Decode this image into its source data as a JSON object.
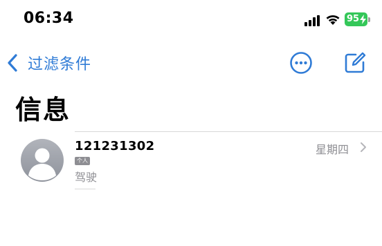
{
  "status_bar": {
    "time": "06:34",
    "battery_level": "95",
    "icons": [
      "signal-icon",
      "wifi-icon",
      "battery-icon"
    ],
    "battery_color": "#34c759"
  },
  "nav": {
    "back_label": "过滤条件",
    "back_icon": "chevron-left-icon",
    "more_icon": "more-icon",
    "compose_icon": "compose-icon",
    "accent_color": "#2f7bd6"
  },
  "page": {
    "title": "信息"
  },
  "conversations": [
    {
      "sender": "121231302",
      "badge": "个人",
      "preview": "驾驶",
      "date": "星期四"
    }
  ]
}
